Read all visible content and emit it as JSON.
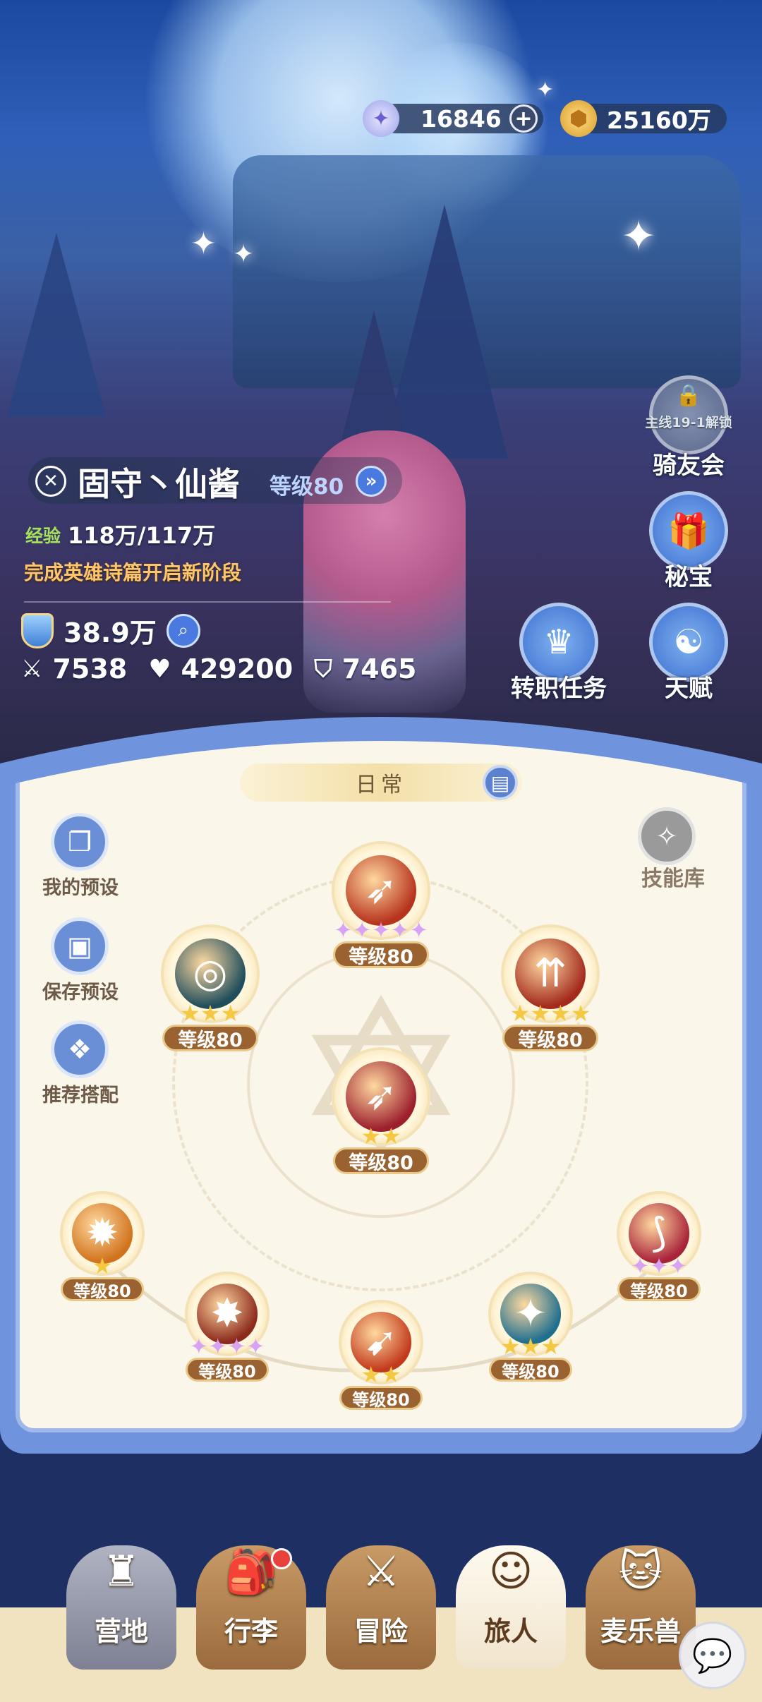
{
  "currency": {
    "diamonds": "16846",
    "gold": "25160万"
  },
  "side_menu": {
    "club_lock": "主线19-1解锁",
    "club": "骑友会",
    "treasure": "秘宝",
    "job_quest": "转职任务",
    "talent": "天赋"
  },
  "character": {
    "name": "固守丶仙酱",
    "level": "等级80",
    "exp_label": "经验",
    "exp_value": "118万/117万",
    "notice": "完成英雄诗篇开启新阶段",
    "power": "38.9万",
    "attack": "7538",
    "hp": "429200",
    "defense": "7465"
  },
  "panel": {
    "tab_label": "日常",
    "my_preset": "我的预设",
    "save_preset": "保存预设",
    "recommend": "推荐搭配",
    "skill_library": "技能库"
  },
  "skills": [
    {
      "level": "等级80",
      "stars": "✦✦✦✦✦",
      "star_color": "#d9a3f5",
      "color": "#b7331d"
    },
    {
      "level": "等级80",
      "stars": "★★★",
      "star_color": "#f5c842",
      "color": "#1f4d5c"
    },
    {
      "level": "等级80",
      "stars": "★★★★",
      "star_color": "#f5c842",
      "color": "#a32a1d"
    },
    {
      "level": "等级80",
      "stars": "★★",
      "star_color": "#f5c842",
      "color": "#9c1f2d"
    },
    {
      "level": "等级80",
      "stars": "★",
      "star_color": "#f5c842",
      "color": "#d1731d"
    },
    {
      "level": "等级80",
      "stars": "✦✦✦✦",
      "star_color": "#d9a3f5",
      "color": "#8c2a1d"
    },
    {
      "level": "等级80",
      "stars": "★★",
      "star_color": "#f5c842",
      "color": "#c23a1d"
    },
    {
      "level": "等级80",
      "stars": "★★★",
      "star_color": "#f5c842",
      "color": "#1f6f8f"
    },
    {
      "level": "等级80",
      "stars": "✦✦✦",
      "star_color": "#d9a3f5",
      "color": "#a8233a"
    }
  ],
  "nav": {
    "camp": "营地",
    "luggage": "行李",
    "adventure": "冒险",
    "traveler": "旅人",
    "pet": "麦乐兽"
  }
}
